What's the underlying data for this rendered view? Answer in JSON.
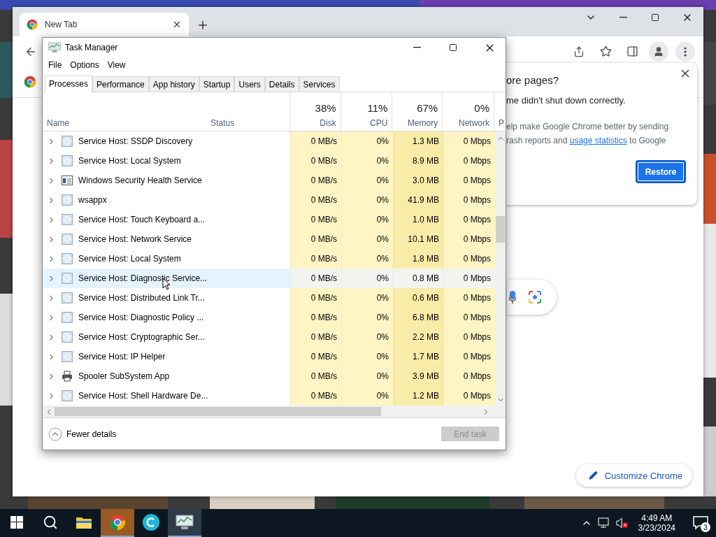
{
  "browser": {
    "tab": {
      "title": "New Tab"
    },
    "restore_prompt": {
      "title": "ore pages?",
      "message": "me didn't shut down correctly.",
      "consent_line_1": "elp make Google Chrome better by sending",
      "consent_before": "rash reports and",
      "consent_link": "usage statistics",
      "consent_after": "to Google",
      "button": "Restore"
    },
    "customize_button": "Customize Chrome"
  },
  "task_manager": {
    "title": "Task Manager",
    "menu": [
      "File",
      "Options",
      "View"
    ],
    "tabs": [
      {
        "label": "Processes",
        "selected": true
      },
      {
        "label": "Performance",
        "selected": false
      },
      {
        "label": "App history",
        "selected": false
      },
      {
        "label": "Startup",
        "selected": false
      },
      {
        "label": "Users",
        "selected": false
      },
      {
        "label": "Details",
        "selected": false
      },
      {
        "label": "Services",
        "selected": false
      }
    ],
    "columns": [
      {
        "label": "Name"
      },
      {
        "label": "Status"
      },
      {
        "label": "Disk",
        "usage": "38%"
      },
      {
        "label": "CPU",
        "usage": "11%"
      },
      {
        "label": "Memory",
        "usage": "67%"
      },
      {
        "label": "Network",
        "usage": "0%"
      },
      {
        "label": "P"
      }
    ],
    "rows": [
      {
        "kind": "service",
        "name": "Service Host: SSDP Discovery",
        "disk": "0 MB/s",
        "cpu": "0%",
        "memory": "1.3 MB",
        "network": "0 Mbps",
        "selected": false
      },
      {
        "kind": "service",
        "name": "Service Host: Local System",
        "disk": "0 MB/s",
        "cpu": "0%",
        "memory": "8.9 MB",
        "network": "0 Mbps",
        "selected": false
      },
      {
        "kind": "window",
        "name": "Windows Security Health Service",
        "disk": "0 MB/s",
        "cpu": "0%",
        "memory": "3.0 MB",
        "network": "0 Mbps",
        "selected": false
      },
      {
        "kind": "service",
        "name": "wsappx",
        "disk": "0 MB/s",
        "cpu": "0%",
        "memory": "41.9 MB",
        "network": "0 Mbps",
        "selected": false
      },
      {
        "kind": "service",
        "name": "Service Host: Touch Keyboard a...",
        "disk": "0 MB/s",
        "cpu": "0%",
        "memory": "1.0 MB",
        "network": "0 Mbps",
        "selected": false
      },
      {
        "kind": "service",
        "name": "Service Host: Network Service",
        "disk": "0 MB/s",
        "cpu": "0%",
        "memory": "10.1 MB",
        "network": "0 Mbps",
        "selected": false
      },
      {
        "kind": "service",
        "name": "Service Host: Local System",
        "disk": "0 MB/s",
        "cpu": "0%",
        "memory": "1.8 MB",
        "network": "0 Mbps",
        "selected": false
      },
      {
        "kind": "service",
        "name": "Service Host: Diagnostic Service...",
        "disk": "0 MB/s",
        "cpu": "0%",
        "memory": "0.8 MB",
        "network": "0 Mbps",
        "selected": true
      },
      {
        "kind": "service",
        "name": "Service Host: Distributed Link Tr...",
        "disk": "0 MB/s",
        "cpu": "0%",
        "memory": "0.6 MB",
        "network": "0 Mbps",
        "selected": false
      },
      {
        "kind": "service",
        "name": "Service Host: Diagnostic Policy ...",
        "disk": "0 MB/s",
        "cpu": "0%",
        "memory": "6.8 MB",
        "network": "0 Mbps",
        "selected": false
      },
      {
        "kind": "service",
        "name": "Service Host: Cryptographic Ser...",
        "disk": "0 MB/s",
        "cpu": "0%",
        "memory": "2.2 MB",
        "network": "0 Mbps",
        "selected": false
      },
      {
        "kind": "service",
        "name": "Service Host: IP Helper",
        "disk": "0 MB/s",
        "cpu": "0%",
        "memory": "1.7 MB",
        "network": "0 Mbps",
        "selected": false
      },
      {
        "kind": "printer",
        "name": "Spooler SubSystem App",
        "disk": "0 MB/s",
        "cpu": "0%",
        "memory": "3.9 MB",
        "network": "0 Mbps",
        "selected": false
      },
      {
        "kind": "service",
        "name": "Service Host: Shell Hardware De...",
        "disk": "0 MB/s",
        "cpu": "0%",
        "memory": "1.2 MB",
        "network": "0 Mbps",
        "selected": false
      }
    ],
    "fewer_details": "Fewer details",
    "end_task": {
      "label": "End task",
      "disabled": true
    }
  },
  "taskbar": {
    "apps": [
      {
        "kind": "explorer",
        "active": false
      },
      {
        "kind": "chrome",
        "active": true
      },
      {
        "kind": "circle-app",
        "active": false
      },
      {
        "kind": "task-manager",
        "active": true
      }
    ],
    "time": "4:49 AM",
    "date": "3/23/2024",
    "notifications": "3"
  }
}
